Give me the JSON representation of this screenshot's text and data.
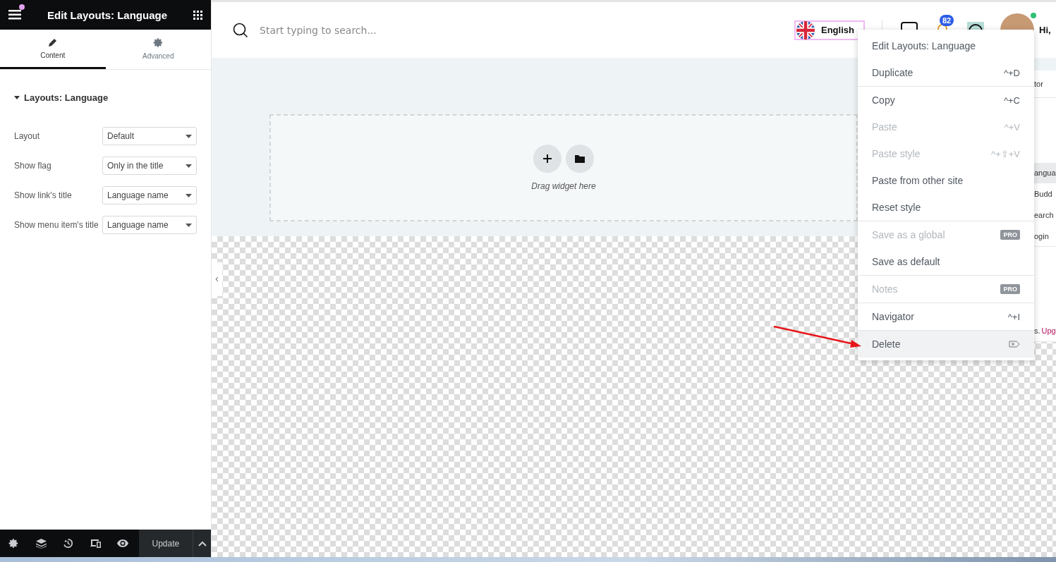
{
  "panel": {
    "title": "Edit Layouts: Language",
    "tabs": [
      {
        "label": "Content",
        "selected": true
      },
      {
        "label": "Advanced",
        "selected": false
      }
    ],
    "section": {
      "title": "Layouts: Language",
      "expanded": true
    },
    "controls": [
      {
        "label": "Layout",
        "value": "Default"
      },
      {
        "label": "Show flag",
        "value": "Only in the title"
      },
      {
        "label": "Show link's title",
        "value": "Language name"
      },
      {
        "label": "Show menu item's title",
        "value": "Language name"
      }
    ],
    "footer": {
      "update": "Update"
    }
  },
  "header": {
    "search": {
      "placeholder": "Start typing to search..."
    },
    "language": "English",
    "notifications": "82",
    "greeting": "Hi,"
  },
  "canvas": {
    "drop_hint": "Drag widget here"
  },
  "background_list": [
    {
      "text": "tor",
      "selected": false
    },
    {
      "text": "angua",
      "selected": true
    },
    {
      "text": "Budd",
      "selected": false
    },
    {
      "text": "earch",
      "selected": false
    },
    {
      "text": "ogin",
      "selected": false
    },
    {
      "text": "s.",
      "link": "Upg",
      "selected": false
    }
  ],
  "context_menu": {
    "groups": [
      [
        {
          "label": "Edit Layouts: Language",
          "kind": "plain",
          "disabled": false,
          "selected": false
        },
        {
          "label": "Duplicate",
          "kind": "shortcut",
          "shortcut": "^+D",
          "disabled": false,
          "selected": false
        }
      ],
      [
        {
          "label": "Copy",
          "kind": "shortcut",
          "shortcut": "^+C",
          "disabled": false,
          "selected": false
        },
        {
          "label": "Paste",
          "kind": "shortcut",
          "shortcut": "^+V",
          "disabled": true,
          "selected": false
        },
        {
          "label": "Paste style",
          "kind": "shortcut",
          "shortcut": "^+⇧+V",
          "disabled": true,
          "selected": false
        },
        {
          "label": "Paste from other site",
          "kind": "plain",
          "disabled": false,
          "selected": false
        },
        {
          "label": "Reset style",
          "kind": "plain",
          "disabled": false,
          "selected": false
        }
      ],
      [
        {
          "label": "Save as a global",
          "kind": "badge",
          "badge": "PRO",
          "disabled": true,
          "selected": false
        },
        {
          "label": "Save as default",
          "kind": "plain",
          "disabled": false,
          "selected": false
        }
      ],
      [
        {
          "label": "Notes",
          "kind": "badge",
          "badge": "PRO",
          "disabled": true,
          "selected": false
        }
      ],
      [
        {
          "label": "Navigator",
          "kind": "shortcut",
          "shortcut": "^+I",
          "disabled": false,
          "selected": false
        }
      ],
      [
        {
          "label": "Delete",
          "kind": "icon",
          "disabled": false,
          "selected": true
        }
      ]
    ]
  }
}
